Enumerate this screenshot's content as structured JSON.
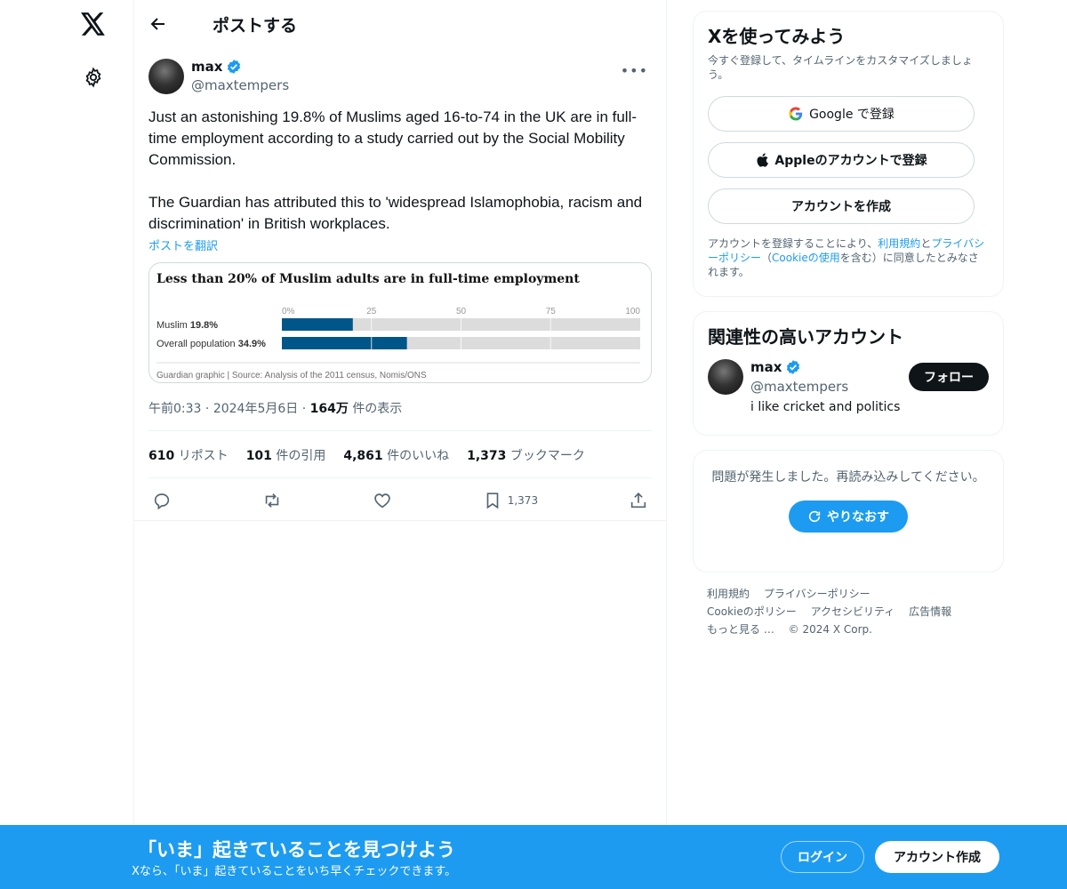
{
  "nav": {
    "logo_icon": "x-logo-icon",
    "settings_icon": "gear-icon"
  },
  "header": {
    "title": "ポストする"
  },
  "post": {
    "author_name": "max",
    "author_handle": "@maxtempers",
    "text_p1": "Just an astonishing 19.8% of Muslims aged 16-to-74 in the UK are in full-time employment according to a study carried out by the Social Mobility Commission.",
    "text_p2": "The Guardian has attributed this to 'widespread Islamophobia, racism and discrimination' in British workplaces.",
    "translate": "ポストを翻訳",
    "time": "午前0:33",
    "date": "2024年5月6日",
    "views_count": "164万",
    "views_label": "件の表示",
    "stats": {
      "reposts_count": "610",
      "reposts_label": "リポスト",
      "quotes_count": "101",
      "quotes_label": "件の引用",
      "likes_count": "4,861",
      "likes_label": "件のいいね",
      "bookmarks_count": "1,373",
      "bookmarks_label": "ブックマーク"
    },
    "bookmark_action_count": "1,373"
  },
  "chart_data": {
    "type": "bar",
    "title": "Less than 20% of Muslim adults are in full-time employment",
    "categories": [
      "Muslim",
      "Overall population"
    ],
    "category_values": [
      "19.8%",
      "34.9%"
    ],
    "values": [
      19.8,
      34.9
    ],
    "xlim": [
      0,
      100
    ],
    "ticks": [
      "0%",
      "25",
      "50",
      "75",
      "100"
    ],
    "source": "Guardian graphic | Source: Analysis of the 2011 census, Nomis/ONS",
    "colors": {
      "bar": "#005689",
      "track": "#dcdcdc"
    }
  },
  "sidebar": {
    "signup_title": "Xを使ってみよう",
    "signup_sub": "今すぐ登録して、タイムラインをカスタマイズしましょう。",
    "google_btn": "Google で登録",
    "apple_btn": "Appleのアカウントで登録",
    "create_btn": "アカウントを作成",
    "legal_1": "アカウントを登録することにより、",
    "legal_terms": "利用規約",
    "legal_and": "と",
    "legal_privacy": "プライバシーポリシー",
    "legal_2": "（",
    "legal_cookie": "Cookieの使用",
    "legal_3": "を含む）に同意したとみなされます。",
    "related_title": "関連性の高いアカウント",
    "related_name": "max",
    "related_handle": "@maxtempers",
    "related_bio": "i like cricket and politics",
    "follow_btn": "フォロー",
    "error_text": "問題が発生しました。再読み込みしてください。",
    "retry_btn": "やりなおす",
    "footer_links": [
      "利用規約",
      "プライバシーポリシー",
      "Cookieのポリシー",
      "アクセシビリティ",
      "広告情報",
      "もっと見る …",
      "© 2024 X Corp."
    ]
  },
  "banner": {
    "title": "「いま」起きていることを見つけよう",
    "sub": "Xなら、「いま」起きていることをいち早くチェックできます。",
    "login": "ログイン",
    "signup": "アカウント作成"
  },
  "colors": {
    "accent": "#1d9bf0",
    "verified": "#1d9bf0"
  }
}
